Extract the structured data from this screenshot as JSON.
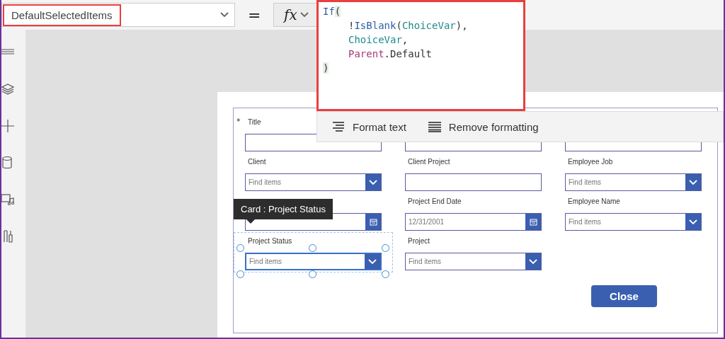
{
  "formula_bar": {
    "property": "DefaultSelectedItems",
    "equals": "=",
    "fx": "fx",
    "lines": [
      {
        "indent": false,
        "tokens": [
          {
            "text": "If",
            "kind": "function"
          },
          {
            "text": "(",
            "kind": "bracket"
          }
        ]
      },
      {
        "indent": true,
        "tokens": [
          {
            "text": "!",
            "kind": "plain"
          },
          {
            "text": "IsBlank",
            "kind": "function"
          },
          {
            "text": "(",
            "kind": "plain"
          },
          {
            "text": "ChoiceVar",
            "kind": "variable"
          },
          {
            "text": "),",
            "kind": "plain"
          }
        ]
      },
      {
        "indent": true,
        "tokens": [
          {
            "text": "ChoiceVar",
            "kind": "variable"
          },
          {
            "text": ",",
            "kind": "plain"
          }
        ]
      },
      {
        "indent": true,
        "tokens": [
          {
            "text": "Parent",
            "kind": "keyword"
          },
          {
            "text": ".Default",
            "kind": "plain"
          }
        ]
      },
      {
        "indent": false,
        "tokens": [
          {
            "text": ")",
            "kind": "bracket"
          }
        ]
      }
    ]
  },
  "format_toolbar": [
    "Format text",
    "Remove formatting"
  ],
  "form": {
    "fields": [
      {
        "label": "Title",
        "mark": "*",
        "kind": "text",
        "selected": false
      },
      {
        "kind": "text",
        "selected": false
      },
      {
        "kind": "text",
        "selected": false
      },
      {
        "label": "Client",
        "kind": "dropdown",
        "placeholder": "Find items",
        "selected": false
      },
      {
        "label": "Client Project",
        "kind": "text",
        "selected": false
      },
      {
        "label": "Employee Job",
        "kind": "dropdown",
        "placeholder": "Find items",
        "selected": false
      },
      {
        "kind": "date",
        "selected": false
      },
      {
        "label": "Project End Date",
        "kind": "date",
        "value": "12/31/2001",
        "selected": false
      },
      {
        "label": "Employee Name",
        "kind": "dropdown",
        "placeholder": "Find items",
        "selected": false
      },
      {
        "label": "Project Status",
        "kind": "dropdown",
        "placeholder": "Find items",
        "selected": true
      },
      {
        "label": "Project",
        "kind": "dropdown",
        "placeholder": "Find items",
        "selected": false
      }
    ],
    "tooltip": "Card : Project Status",
    "close_button": "Close"
  }
}
